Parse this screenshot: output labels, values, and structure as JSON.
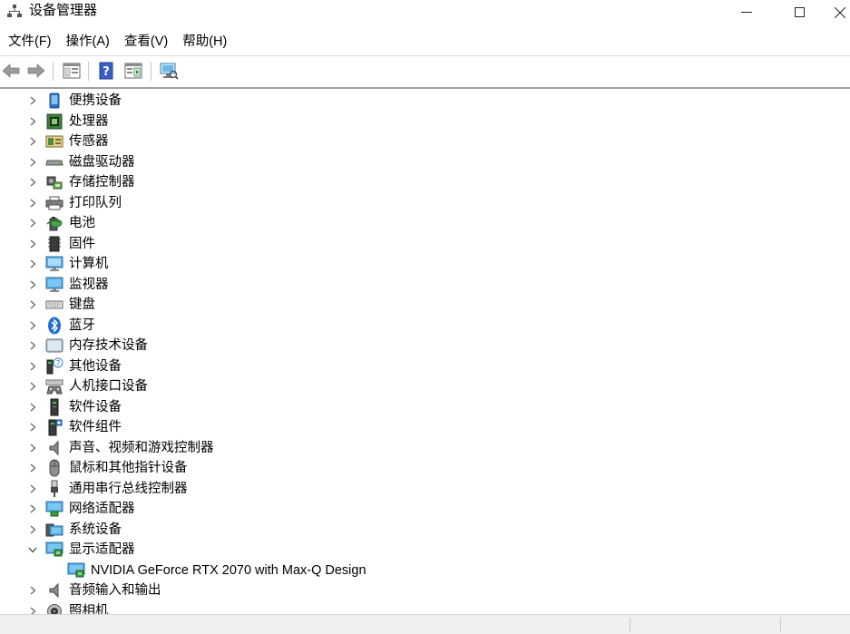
{
  "window": {
    "title": "设备管理器",
    "icon": "device-manager-icon",
    "controls": [
      "minimize-icon",
      "maximize-icon",
      "close-icon"
    ]
  },
  "menu": {
    "items": [
      {
        "label": "文件(F)"
      },
      {
        "label": "操作(A)"
      },
      {
        "label": "查看(V)"
      },
      {
        "label": "帮助(H)"
      }
    ]
  },
  "toolbar": {
    "buttons": [
      {
        "icon": "back-arrow-icon"
      },
      {
        "icon": "forward-arrow-icon"
      },
      {
        "icon": "show-hide-console-tree-icon"
      },
      {
        "icon": "help-icon"
      },
      {
        "icon": "properties-pane-icon"
      },
      {
        "icon": "scan-hardware-changes-icon"
      }
    ]
  },
  "tree": {
    "nodes": [
      {
        "label": "便携设备",
        "icon": "portable-device-icon",
        "expanded": false
      },
      {
        "label": "处理器",
        "icon": "processor-icon",
        "expanded": false
      },
      {
        "label": "传感器",
        "icon": "sensor-icon",
        "expanded": false
      },
      {
        "label": "磁盘驱动器",
        "icon": "disk-drive-icon",
        "expanded": false
      },
      {
        "label": "存储控制器",
        "icon": "storage-controller-icon",
        "expanded": false
      },
      {
        "label": "打印队列",
        "icon": "printer-icon",
        "expanded": false
      },
      {
        "label": "电池",
        "icon": "battery-icon",
        "expanded": false
      },
      {
        "label": "固件",
        "icon": "firmware-icon",
        "expanded": false
      },
      {
        "label": "计算机",
        "icon": "computer-icon",
        "expanded": false
      },
      {
        "label": "监视器",
        "icon": "monitor-icon",
        "expanded": false
      },
      {
        "label": "键盘",
        "icon": "keyboard-icon",
        "expanded": false
      },
      {
        "label": "蓝牙",
        "icon": "bluetooth-icon",
        "expanded": false
      },
      {
        "label": "内存技术设备",
        "icon": "memory-technology-icon",
        "expanded": false
      },
      {
        "label": "其他设备",
        "icon": "other-device-icon",
        "expanded": false
      },
      {
        "label": "人机接口设备",
        "icon": "hid-icon",
        "expanded": false
      },
      {
        "label": "软件设备",
        "icon": "software-device-icon",
        "expanded": false
      },
      {
        "label": "软件组件",
        "icon": "software-component-icon",
        "expanded": false
      },
      {
        "label": "声音、视频和游戏控制器",
        "icon": "speaker-icon",
        "expanded": false
      },
      {
        "label": "鼠标和其他指针设备",
        "icon": "mouse-icon",
        "expanded": false
      },
      {
        "label": "通用串行总线控制器",
        "icon": "usb-icon",
        "expanded": false
      },
      {
        "label": "网络适配器",
        "icon": "network-adapter-icon",
        "expanded": false
      },
      {
        "label": "系统设备",
        "icon": "system-device-icon",
        "expanded": false
      },
      {
        "label": "显示适配器",
        "icon": "display-adapter-icon",
        "expanded": true,
        "children": [
          {
            "label": "NVIDIA GeForce RTX 2070 with Max-Q Design",
            "icon": "display-adapter-icon"
          }
        ]
      },
      {
        "label": "音频输入和输出",
        "icon": "audio-io-icon",
        "expanded": false
      },
      {
        "label": "照相机",
        "icon": "camera-icon",
        "expanded": false
      }
    ]
  }
}
